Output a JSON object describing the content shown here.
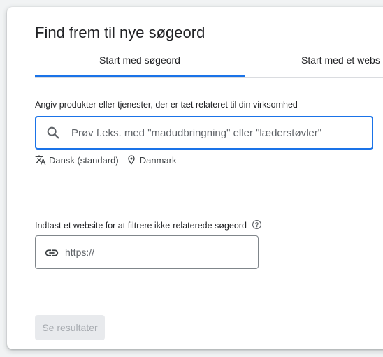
{
  "title": "Find frem til nye søgeord",
  "tabs": [
    {
      "label": "Start med søgeord",
      "active": true
    },
    {
      "label": "Start med et webs",
      "active": false
    }
  ],
  "keywords": {
    "label": "Angiv produkter eller tjenester, der er tæt relateret til din virksomhed",
    "placeholder": "Prøv f.eks. med \"madudbringning\" eller \"læderstøvler\"",
    "value": "",
    "language": "Dansk (standard)",
    "location": "Danmark"
  },
  "website": {
    "label": "Indtast et website for at filtrere ikke-relaterede søgeord",
    "placeholder": "https://",
    "value": ""
  },
  "submit": {
    "label": "Se resultater",
    "enabled": false
  },
  "colors": {
    "accent": "#1a73e8",
    "text": "#202124",
    "muted": "#5f6368",
    "disabled_bg": "#e8eaed",
    "disabled_text": "#a7abb0"
  },
  "icons": {
    "search": "search-icon",
    "translate": "translate-icon",
    "location": "location-pin-icon",
    "help": "help-circle-icon",
    "link": "link-icon"
  }
}
